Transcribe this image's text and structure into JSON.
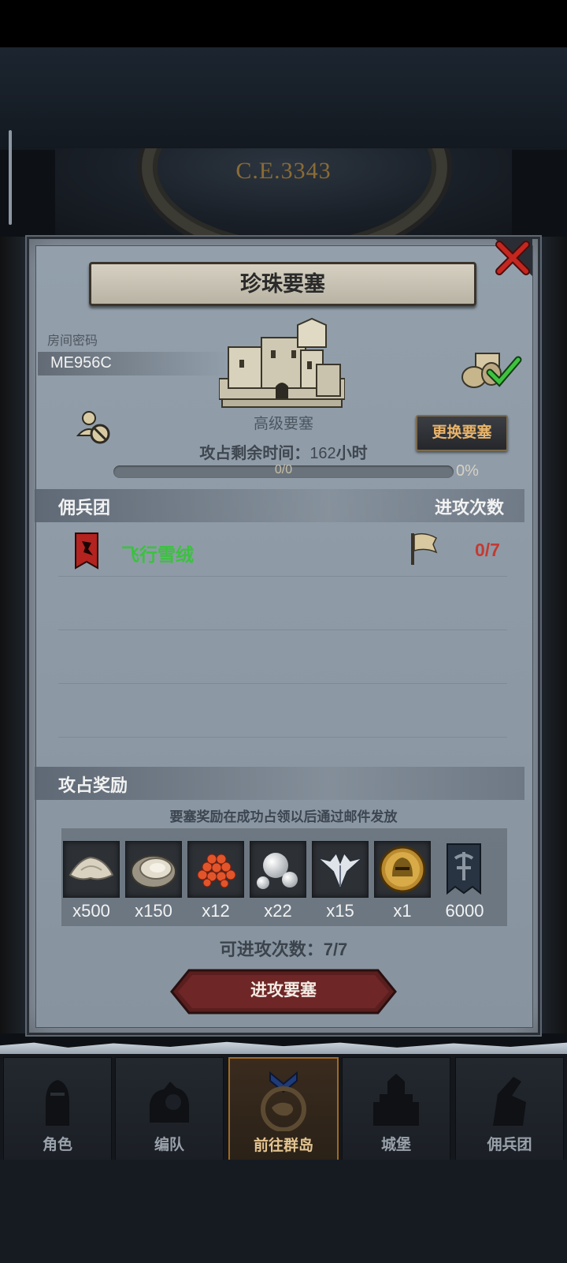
{
  "header": {
    "era": "C.E.3343"
  },
  "dialog": {
    "title": "珍珠要塞",
    "room_code_label": "房间密码",
    "room_code": "ME956C",
    "fortress_level": "高级要塞",
    "time_label": "攻占剩余时间：",
    "time_value": "162",
    "time_unit": "小时",
    "change_button": "更换要塞",
    "progress_text": "0/0",
    "progress_percent": "0%",
    "progress_fraction": 0
  },
  "mercenary": {
    "header": "佣兵团",
    "attack_header": "进攻次数",
    "rows": [
      {
        "name": "飞行雪绒",
        "attacks": "0/7"
      }
    ]
  },
  "rewards": {
    "header": "攻占奖励",
    "note": "要塞奖励在成功占领以后通过邮件发放",
    "items": [
      {
        "icon": "salt-icon",
        "qty": "x500"
      },
      {
        "icon": "oyster-icon",
        "qty": "x150"
      },
      {
        "icon": "fish-roe-icon",
        "qty": "x12"
      },
      {
        "icon": "pearl-icon",
        "qty": "x22"
      },
      {
        "icon": "wing-emblem-icon",
        "qty": "x15"
      },
      {
        "icon": "gold-helmet-coin-icon",
        "qty": "x1"
      },
      {
        "icon": "guild-banner-icon",
        "qty": "6000"
      }
    ]
  },
  "attempts": "可进攻次数：7/7",
  "attack_button": "进攻要塞",
  "nav": [
    {
      "label": "角色",
      "icon": "knight-icon"
    },
    {
      "label": "编队",
      "icon": "formation-icon"
    },
    {
      "label": "前往群岛",
      "icon": "islands-icon",
      "active": true
    },
    {
      "label": "城堡",
      "icon": "castle-icon"
    },
    {
      "label": "佣兵团",
      "icon": "mercenary-icon"
    }
  ],
  "colors": {
    "merc_name": "#39c33c",
    "attack_count": "#c43a32",
    "change_button_text": "#e9b46a",
    "active_tab_border": "#a06a22"
  }
}
